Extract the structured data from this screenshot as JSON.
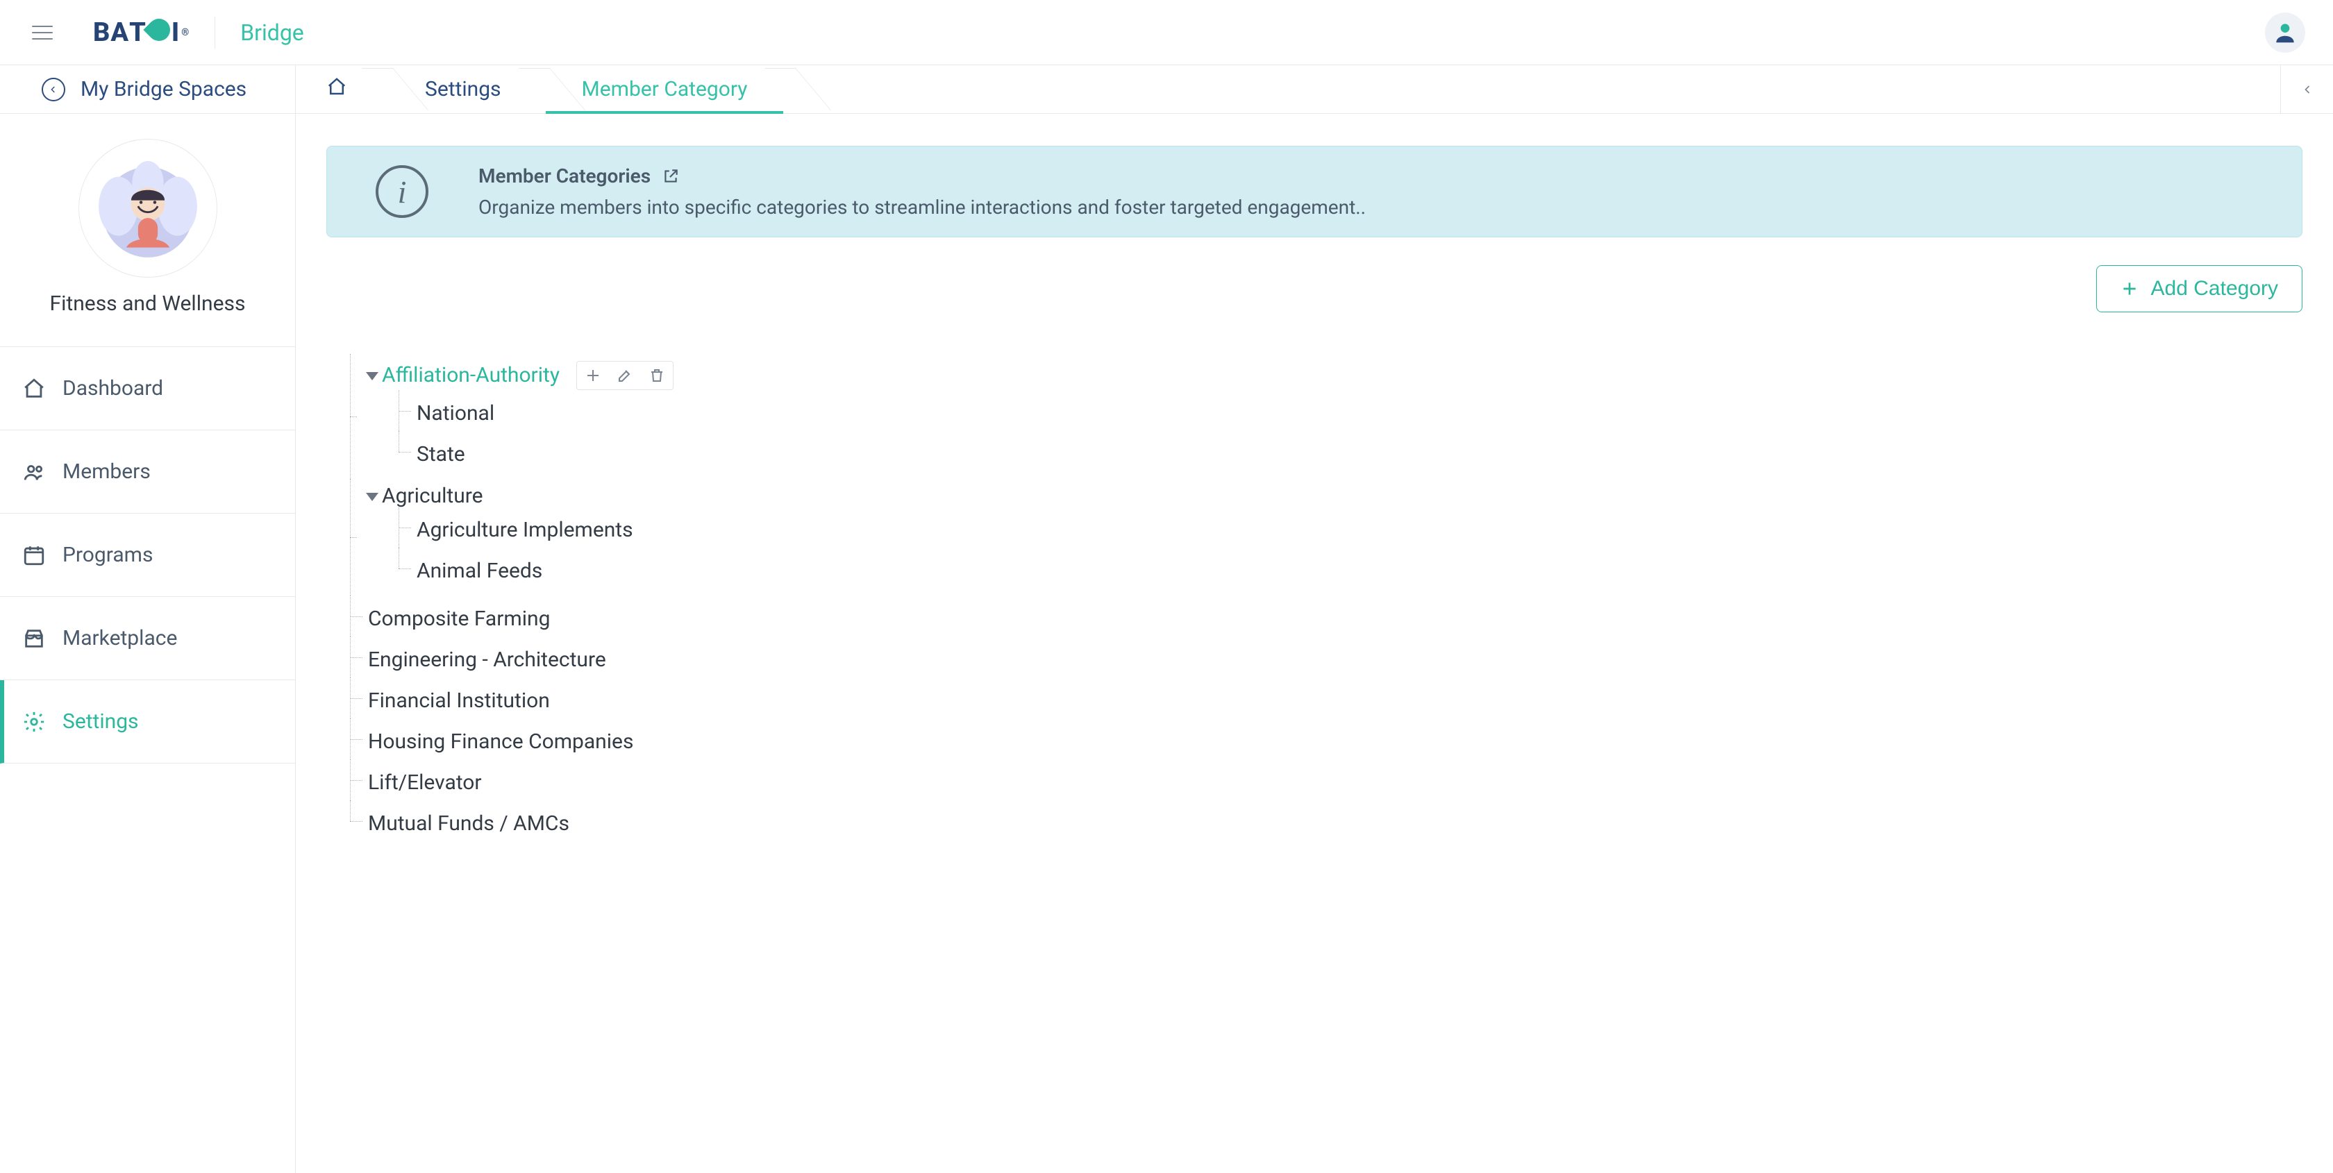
{
  "header": {
    "logo_text": "BAT I",
    "bridge_label": "Bridge"
  },
  "subheader": {
    "my_spaces": "My Bridge Spaces",
    "crumbs": [
      {
        "label": "Settings",
        "active": false
      },
      {
        "label": "Member Category",
        "active": true
      }
    ]
  },
  "sidebar": {
    "space_name": "Fitness and Wellness",
    "items": [
      {
        "key": "dashboard",
        "label": "Dashboard",
        "icon": "home-icon"
      },
      {
        "key": "members",
        "label": "Members",
        "icon": "users-icon"
      },
      {
        "key": "programs",
        "label": "Programs",
        "icon": "calendar-icon"
      },
      {
        "key": "marketplace",
        "label": "Marketplace",
        "icon": "store-icon"
      },
      {
        "key": "settings",
        "label": "Settings",
        "icon": "gear-icon",
        "active": true
      }
    ]
  },
  "notice": {
    "title": "Member Categories",
    "description": "Organize members into specific categories to streamline interactions and foster targeted engagement.."
  },
  "buttons": {
    "add_category": "Add Category"
  },
  "tree": [
    {
      "label": "Affiliation-Authority",
      "active": true,
      "expanded": true,
      "children": [
        {
          "label": "National"
        },
        {
          "label": "State"
        }
      ]
    },
    {
      "label": "Agriculture",
      "expanded": true,
      "children": [
        {
          "label": "Agriculture Implements"
        },
        {
          "label": "Animal Feeds"
        }
      ]
    },
    {
      "label": "Composite Farming"
    },
    {
      "label": "Engineering - Architecture"
    },
    {
      "label": "Financial Institution"
    },
    {
      "label": "Housing Finance Companies"
    },
    {
      "label": "Lift/Elevator"
    },
    {
      "label": "Mutual Funds / AMCs"
    }
  ],
  "colors": {
    "accent": "#2bb79e",
    "notice_bg": "#d3edf2",
    "link_blue": "#2b4c7e"
  }
}
